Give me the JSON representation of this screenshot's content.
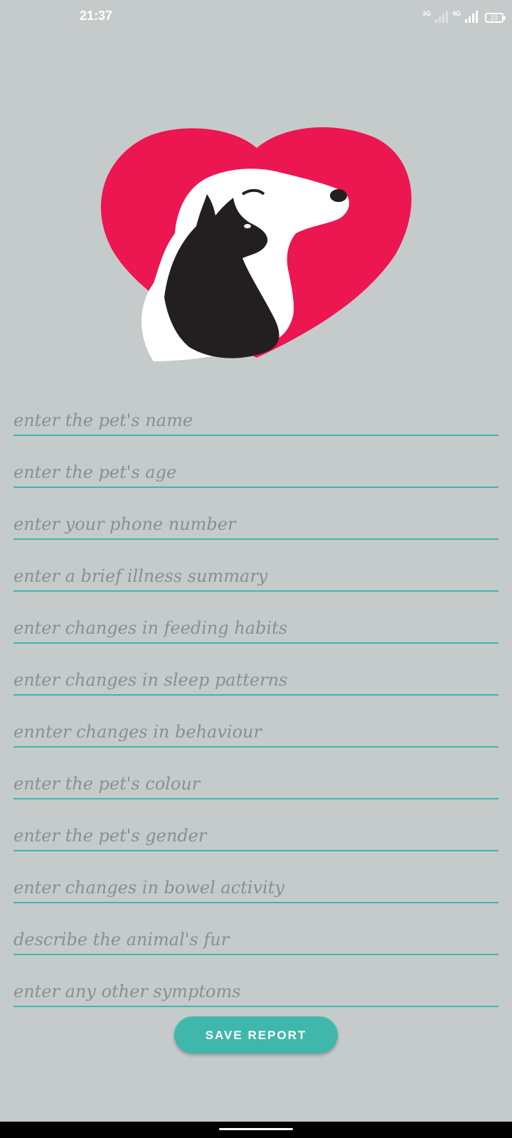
{
  "status_bar": {
    "time": "21:37",
    "network_1": "3G",
    "network_2": "4G",
    "battery": "23"
  },
  "logo": {
    "icon": "heart-dog-cat-logo",
    "heart_color": "#ec1651",
    "dog_color": "#ffffff",
    "cat_color": "#231f20"
  },
  "form": {
    "fields": [
      {
        "placeholder": "enter the pet's name"
      },
      {
        "placeholder": "enter the pet's age"
      },
      {
        "placeholder": "enter your phone number"
      },
      {
        "placeholder": "enter a brief illness summary"
      },
      {
        "placeholder": "enter changes in feeding habits"
      },
      {
        "placeholder": "enter changes in sleep patterns"
      },
      {
        "placeholder": "ennter changes in behaviour"
      },
      {
        "placeholder": "enter the pet's colour"
      },
      {
        "placeholder": "enter the pet's gender"
      },
      {
        "placeholder": "enter changes in bowel activity"
      },
      {
        "placeholder": "describe the animal's fur"
      },
      {
        "placeholder": "enter any other symptoms"
      }
    ],
    "underline_color": "#3fb7ab"
  },
  "actions": {
    "save_label": "SAVE REPORT",
    "save_color": "#3fb8ab"
  },
  "theme": {
    "background": "#c5cbcb"
  }
}
